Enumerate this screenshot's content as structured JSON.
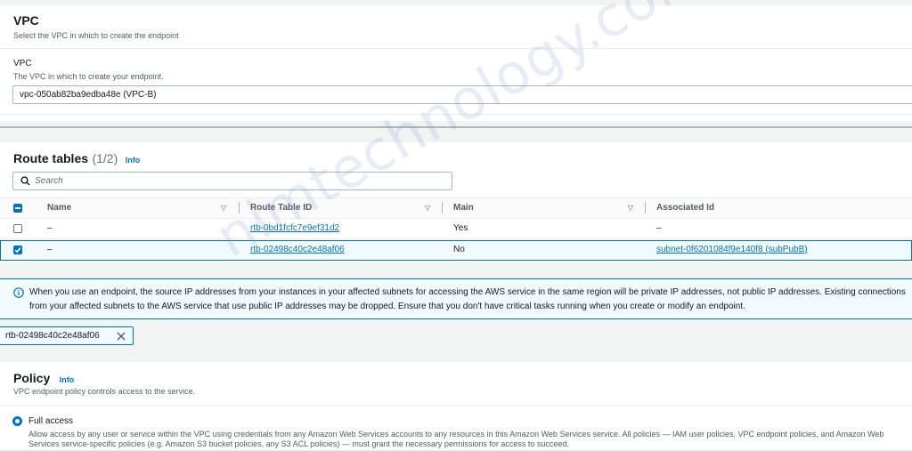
{
  "vpc_section": {
    "title": "VPC",
    "description": "Select the VPC in which to create the endpoint",
    "field_label": "VPC",
    "field_description": "The VPC in which to create your endpoint.",
    "selected_value": "vpc-050ab82ba9edba48e (VPC-B)"
  },
  "route_tables": {
    "title": "Route tables",
    "count": "(1/2)",
    "info_label": "Info",
    "search_placeholder": "Search",
    "columns": [
      "Name",
      "Route Table ID",
      "Main",
      "Associated Id"
    ],
    "rows": [
      {
        "selected": false,
        "name": "–",
        "route_table_id": "rtb-0bd1fcfc7e9ef31d2",
        "main": "Yes",
        "associated_id": "–"
      },
      {
        "selected": true,
        "name": "–",
        "route_table_id": "rtb-02498c40c2e48af06",
        "main": "No",
        "associated_id": "subnet-0f6201084f9e140f8 (subPubB)"
      }
    ]
  },
  "alert": {
    "text": "When you use an endpoint, the source IP addresses from your instances in your affected subnets for accessing the AWS service in the same region will be private IP addresses, not public IP addresses. Existing connections from your affected subnets to the AWS service that use public IP addresses may be dropped. Ensure that you don't have critical tasks running when you create or modify an endpoint."
  },
  "token": {
    "label": "rtb-02498c40c2e48af06"
  },
  "policy": {
    "title": "Policy",
    "info_label": "Info",
    "description": "VPC endpoint policy controls access to the service.",
    "option_label": "Full access",
    "option_description": "Allow access by any user or service within the VPC using credentials from any Amazon Web Services accounts to any resources in this Amazon Web Services service. All policies — IAM user policies, VPC endpoint policies, and Amazon Web Services service-specific policies (e.g. Amazon S3 bucket policies, any S3 ACL policies) — must grant the necessary permissions for access to succeed."
  },
  "watermark": "nimtechnology.com",
  "colors": {
    "accent": "#0073bb",
    "page_bg": "#f2f3f3",
    "panel_bg": "#ffffff",
    "selected_row_bg": "#f1faff"
  },
  "icons": [
    "search-icon",
    "info-circle-icon",
    "close-icon",
    "sort-down-icon",
    "radio-selected-icon",
    "checkbox-icon"
  ]
}
